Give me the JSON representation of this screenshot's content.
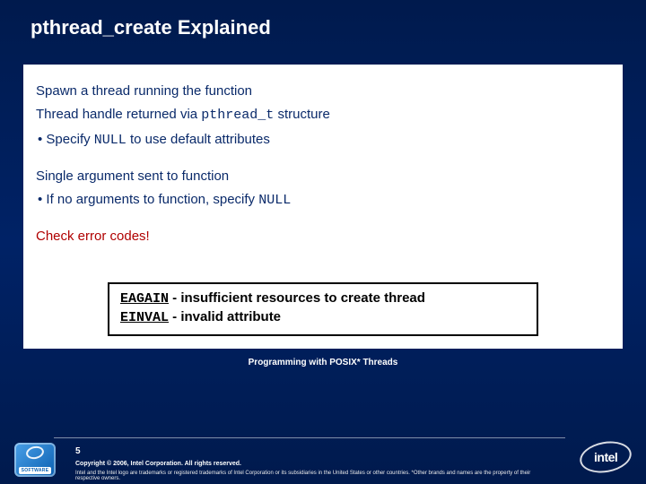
{
  "title": "pthread_create Explained",
  "body": {
    "p1": "Spawn a thread running the function",
    "p2_a": "Thread handle returned via ",
    "p2_code": "pthread_t",
    "p2_b": " structure",
    "b1_a": "• Specify ",
    "b1_code": "NULL",
    "b1_b": " to use default attributes",
    "p3": "Single argument sent to function",
    "b2_a": "• If no arguments to function, specify ",
    "b2_code": "NULL",
    "p4": "Check error codes!"
  },
  "errors": {
    "e1_code": "EAGAIN",
    "e1_text": " - insufficient resources to create thread",
    "e2_code": "EINVAL",
    "e2_text": " - invalid attribute"
  },
  "footer": {
    "series": "Programming with POSIX* Threads",
    "page": "5",
    "copyright": "Copyright © 2006, Intel Corporation. All rights reserved.",
    "trademark": "Intel and the Intel logo are trademarks or registered trademarks of Intel Corporation or its subsidiaries in the United States or other countries. *Other brands and names are the property of their respective owners.",
    "badge_label": "SOFTWARE",
    "logo_text": "intel"
  }
}
